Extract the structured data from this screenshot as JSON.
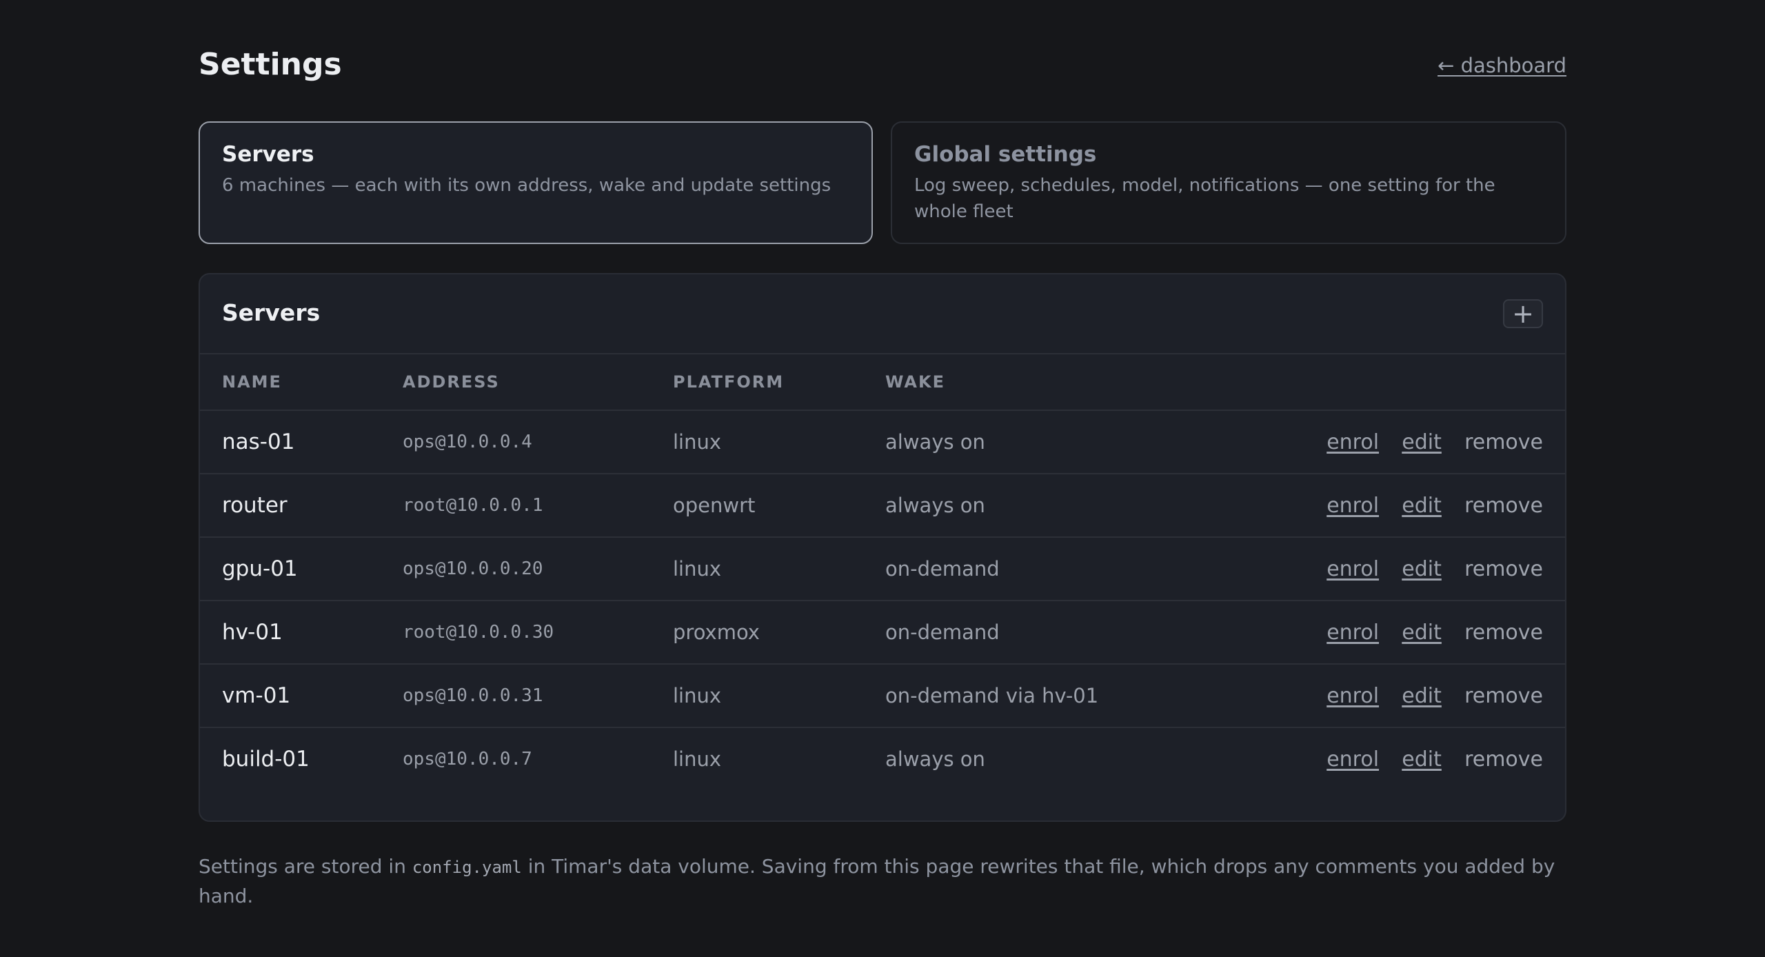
{
  "header": {
    "title": "Settings",
    "back_link": "← dashboard"
  },
  "cards": [
    {
      "title": "Servers",
      "description": "6 machines — each with its own address, wake and update settings",
      "active": true
    },
    {
      "title": "Global settings",
      "description": "Log sweep, schedules, model, notifications — one setting for the whole fleet",
      "active": false
    }
  ],
  "panel": {
    "title": "Servers",
    "add_icon": "plus-icon",
    "add_label": "+"
  },
  "table": {
    "columns": [
      "NAME",
      "ADDRESS",
      "PLATFORM",
      "WAKE"
    ],
    "actions": {
      "enrol": "enrol",
      "edit": "edit",
      "remove": "remove"
    },
    "rows": [
      {
        "name": "nas-01",
        "address": "ops@10.0.0.4",
        "platform": "linux",
        "wake": "always on"
      },
      {
        "name": "router",
        "address": "root@10.0.0.1",
        "platform": "openwrt",
        "wake": "always on"
      },
      {
        "name": "gpu-01",
        "address": "ops@10.0.0.20",
        "platform": "linux",
        "wake": "on-demand"
      },
      {
        "name": "hv-01",
        "address": "root@10.0.0.30",
        "platform": "proxmox",
        "wake": "on-demand"
      },
      {
        "name": "vm-01",
        "address": "ops@10.0.0.31",
        "platform": "linux",
        "wake": "on-demand via hv-01"
      },
      {
        "name": "build-01",
        "address": "ops@10.0.0.7",
        "platform": "linux",
        "wake": "always on"
      }
    ]
  },
  "footnote": {
    "before": "Settings are stored in ",
    "code": "config.yaml",
    "after": " in Timar's data volume. Saving from this page rewrites that file, which drops any comments you added by hand."
  },
  "colors": {
    "background": "#16171a",
    "panel": "#1d2028",
    "active_border": "#9ca1ab",
    "text": "#eceef1",
    "muted": "#8f95a1"
  }
}
